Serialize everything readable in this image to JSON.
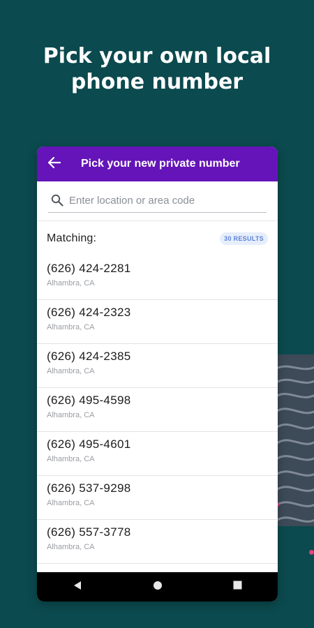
{
  "headline": {
    "line1": "Pick your own local",
    "line2": "phone number"
  },
  "appbar": {
    "title": "Pick your new private number",
    "back_icon": "arrow-left-icon"
  },
  "search": {
    "placeholder": "Enter location or area code",
    "icon": "search-icon"
  },
  "matching": {
    "label": "Matching:",
    "results_badge": "30 RESULTS"
  },
  "numbers": [
    {
      "number": "(626) 424-2281",
      "location": "Alhambra, CA"
    },
    {
      "number": "(626) 424-2323",
      "location": "Alhambra, CA"
    },
    {
      "number": "(626) 424-2385",
      "location": "Alhambra, CA"
    },
    {
      "number": "(626) 495-4598",
      "location": "Alhambra, CA"
    },
    {
      "number": "(626) 495-4601",
      "location": "Alhambra, CA"
    },
    {
      "number": "(626) 537-9298",
      "location": "Alhambra, CA"
    },
    {
      "number": "(626) 557-3778",
      "location": "Alhambra, CA"
    }
  ],
  "navbar": {
    "icons": [
      "back-triangle-icon",
      "home-circle-icon",
      "recents-square-icon"
    ]
  },
  "colors": {
    "background": "#0b4a4e",
    "appbar": "#6414b8",
    "badge_bg": "#e6eefb",
    "badge_text": "#5c84d6",
    "accent_dot": "#e0457b"
  }
}
